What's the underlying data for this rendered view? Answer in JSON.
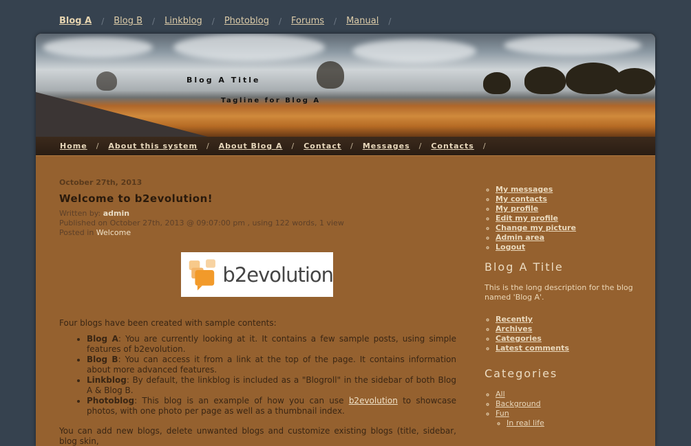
{
  "topnav": [
    "Blog A",
    "Blog B",
    "Linkblog",
    "Photoblog",
    "Forums",
    "Manual"
  ],
  "header": {
    "blog_title": "Blog A Title",
    "tagline": "Tagline for Blog A"
  },
  "menu": [
    "Home",
    "About this system",
    "About Blog A",
    "Contact",
    "Messages",
    "Contacts"
  ],
  "post": {
    "date": "October 27th, 2013",
    "title": "Welcome to b2evolution!",
    "written_by_label": "Written by:",
    "author": "admin",
    "published": "Published on October 27th, 2013 @ 09:07:00 pm , using 122 words, 1 view",
    "posted_in_label": "Posted in",
    "category": "Welcome",
    "logo_text": "b2evolution",
    "intro": "Four blogs have been created with sample contents:",
    "items": [
      {
        "name": "Blog A",
        "text": ": You are currently looking at it. It contains a few sample posts, using simple features of b2evolution."
      },
      {
        "name": "Blog B",
        "text": ": You can access it from a link at the top of the page. It contains information about more advanced features."
      },
      {
        "name": "Linkblog",
        "text": ": By default, the linkblog is included as a \"Blogroll\" in the sidebar of both Blog A & Blog B."
      },
      {
        "name": "Photoblog",
        "text_before": ": This blog is an example of how you can use ",
        "link": "b2evolution",
        "text_after": " to showcase photos, with one photo per page as well as a thumbnail index."
      }
    ],
    "outro": "You can add new blogs, delete unwanted blogs and customize existing blogs (title, sidebar, blog skin,"
  },
  "sidebar": {
    "user_links": [
      "My messages",
      "My contacts",
      "My profile",
      "Edit my profile",
      "Change my picture",
      "Admin area",
      "Logout"
    ],
    "blog_heading": "Blog A Title",
    "blog_desc": "This is the long description for the blog named 'Blog A'.",
    "nav_links": [
      "Recently",
      "Archives",
      "Categories",
      "Latest comments"
    ],
    "categories_heading": "Categories",
    "categories": [
      "All",
      "Background",
      "Fun"
    ],
    "subcategories": [
      "In real life"
    ]
  }
}
